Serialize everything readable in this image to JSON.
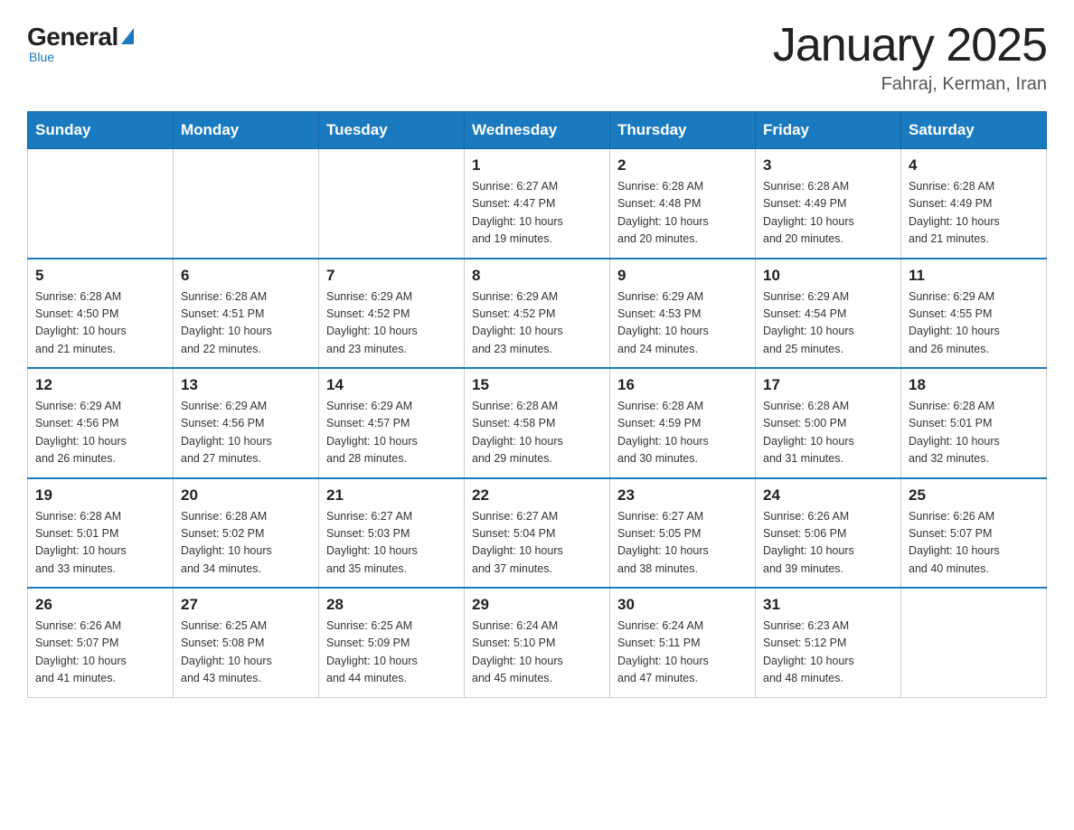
{
  "logo": {
    "general": "General",
    "blue": "Blue",
    "subtitle": "Blue"
  },
  "header": {
    "title": "January 2025",
    "location": "Fahraj, Kerman, Iran"
  },
  "days_of_week": [
    "Sunday",
    "Monday",
    "Tuesday",
    "Wednesday",
    "Thursday",
    "Friday",
    "Saturday"
  ],
  "weeks": [
    [
      {
        "day": "",
        "info": ""
      },
      {
        "day": "",
        "info": ""
      },
      {
        "day": "",
        "info": ""
      },
      {
        "day": "1",
        "info": "Sunrise: 6:27 AM\nSunset: 4:47 PM\nDaylight: 10 hours\nand 19 minutes."
      },
      {
        "day": "2",
        "info": "Sunrise: 6:28 AM\nSunset: 4:48 PM\nDaylight: 10 hours\nand 20 minutes."
      },
      {
        "day": "3",
        "info": "Sunrise: 6:28 AM\nSunset: 4:49 PM\nDaylight: 10 hours\nand 20 minutes."
      },
      {
        "day": "4",
        "info": "Sunrise: 6:28 AM\nSunset: 4:49 PM\nDaylight: 10 hours\nand 21 minutes."
      }
    ],
    [
      {
        "day": "5",
        "info": "Sunrise: 6:28 AM\nSunset: 4:50 PM\nDaylight: 10 hours\nand 21 minutes."
      },
      {
        "day": "6",
        "info": "Sunrise: 6:28 AM\nSunset: 4:51 PM\nDaylight: 10 hours\nand 22 minutes."
      },
      {
        "day": "7",
        "info": "Sunrise: 6:29 AM\nSunset: 4:52 PM\nDaylight: 10 hours\nand 23 minutes."
      },
      {
        "day": "8",
        "info": "Sunrise: 6:29 AM\nSunset: 4:52 PM\nDaylight: 10 hours\nand 23 minutes."
      },
      {
        "day": "9",
        "info": "Sunrise: 6:29 AM\nSunset: 4:53 PM\nDaylight: 10 hours\nand 24 minutes."
      },
      {
        "day": "10",
        "info": "Sunrise: 6:29 AM\nSunset: 4:54 PM\nDaylight: 10 hours\nand 25 minutes."
      },
      {
        "day": "11",
        "info": "Sunrise: 6:29 AM\nSunset: 4:55 PM\nDaylight: 10 hours\nand 26 minutes."
      }
    ],
    [
      {
        "day": "12",
        "info": "Sunrise: 6:29 AM\nSunset: 4:56 PM\nDaylight: 10 hours\nand 26 minutes."
      },
      {
        "day": "13",
        "info": "Sunrise: 6:29 AM\nSunset: 4:56 PM\nDaylight: 10 hours\nand 27 minutes."
      },
      {
        "day": "14",
        "info": "Sunrise: 6:29 AM\nSunset: 4:57 PM\nDaylight: 10 hours\nand 28 minutes."
      },
      {
        "day": "15",
        "info": "Sunrise: 6:28 AM\nSunset: 4:58 PM\nDaylight: 10 hours\nand 29 minutes."
      },
      {
        "day": "16",
        "info": "Sunrise: 6:28 AM\nSunset: 4:59 PM\nDaylight: 10 hours\nand 30 minutes."
      },
      {
        "day": "17",
        "info": "Sunrise: 6:28 AM\nSunset: 5:00 PM\nDaylight: 10 hours\nand 31 minutes."
      },
      {
        "day": "18",
        "info": "Sunrise: 6:28 AM\nSunset: 5:01 PM\nDaylight: 10 hours\nand 32 minutes."
      }
    ],
    [
      {
        "day": "19",
        "info": "Sunrise: 6:28 AM\nSunset: 5:01 PM\nDaylight: 10 hours\nand 33 minutes."
      },
      {
        "day": "20",
        "info": "Sunrise: 6:28 AM\nSunset: 5:02 PM\nDaylight: 10 hours\nand 34 minutes."
      },
      {
        "day": "21",
        "info": "Sunrise: 6:27 AM\nSunset: 5:03 PM\nDaylight: 10 hours\nand 35 minutes."
      },
      {
        "day": "22",
        "info": "Sunrise: 6:27 AM\nSunset: 5:04 PM\nDaylight: 10 hours\nand 37 minutes."
      },
      {
        "day": "23",
        "info": "Sunrise: 6:27 AM\nSunset: 5:05 PM\nDaylight: 10 hours\nand 38 minutes."
      },
      {
        "day": "24",
        "info": "Sunrise: 6:26 AM\nSunset: 5:06 PM\nDaylight: 10 hours\nand 39 minutes."
      },
      {
        "day": "25",
        "info": "Sunrise: 6:26 AM\nSunset: 5:07 PM\nDaylight: 10 hours\nand 40 minutes."
      }
    ],
    [
      {
        "day": "26",
        "info": "Sunrise: 6:26 AM\nSunset: 5:07 PM\nDaylight: 10 hours\nand 41 minutes."
      },
      {
        "day": "27",
        "info": "Sunrise: 6:25 AM\nSunset: 5:08 PM\nDaylight: 10 hours\nand 43 minutes."
      },
      {
        "day": "28",
        "info": "Sunrise: 6:25 AM\nSunset: 5:09 PM\nDaylight: 10 hours\nand 44 minutes."
      },
      {
        "day": "29",
        "info": "Sunrise: 6:24 AM\nSunset: 5:10 PM\nDaylight: 10 hours\nand 45 minutes."
      },
      {
        "day": "30",
        "info": "Sunrise: 6:24 AM\nSunset: 5:11 PM\nDaylight: 10 hours\nand 47 minutes."
      },
      {
        "day": "31",
        "info": "Sunrise: 6:23 AM\nSunset: 5:12 PM\nDaylight: 10 hours\nand 48 minutes."
      },
      {
        "day": "",
        "info": ""
      }
    ]
  ]
}
